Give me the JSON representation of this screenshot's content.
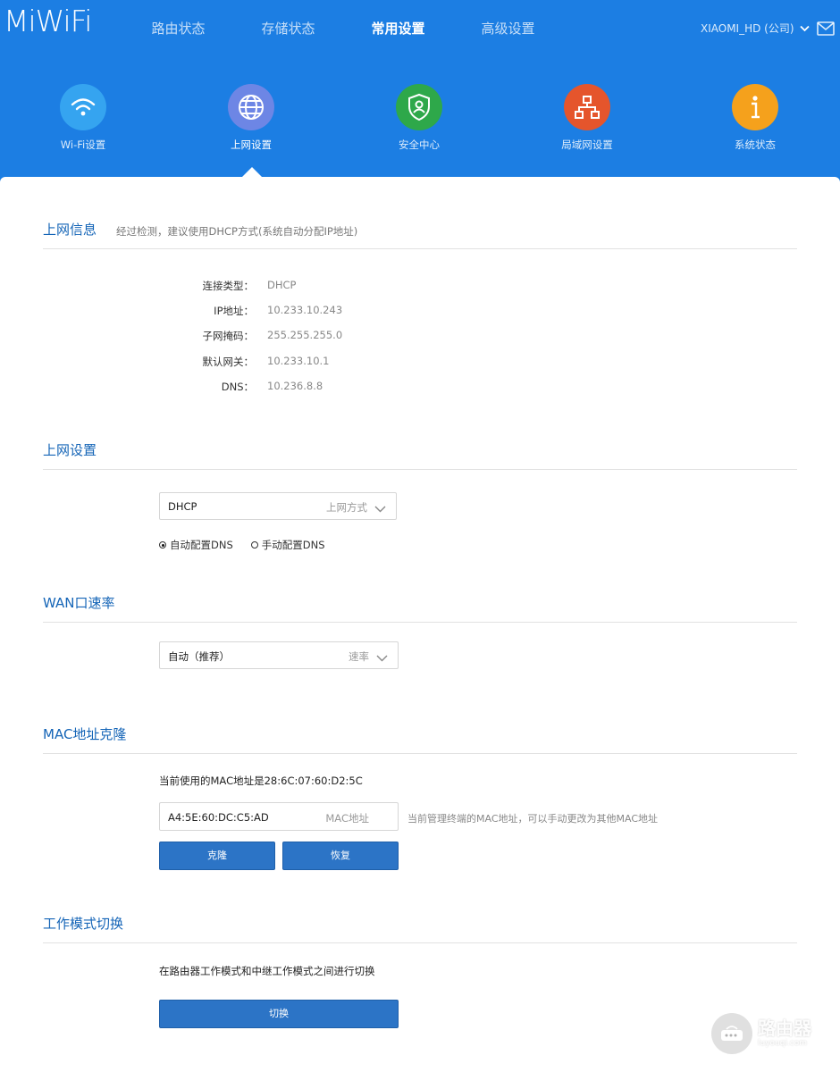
{
  "header": {
    "logo": "MiWiFi",
    "nav": [
      {
        "label": "路由状态"
      },
      {
        "label": "存储状态"
      },
      {
        "label": "常用设置"
      },
      {
        "label": "高级设置"
      }
    ],
    "account": "XIAOMI_HD (公司)"
  },
  "icons": [
    {
      "label": "Wi-Fi设置",
      "color": "#35a4f0",
      "icon": "wifi-icon"
    },
    {
      "label": "上网设置",
      "color": "#6d86e5",
      "icon": "globe-icon"
    },
    {
      "label": "安全中心",
      "color": "#2ea84a",
      "icon": "shield-icon"
    },
    {
      "label": "局域网设置",
      "color": "#e5552c",
      "icon": "network-icon"
    },
    {
      "label": "系统状态",
      "color": "#f5a11c",
      "icon": "info-icon"
    }
  ],
  "wan_info": {
    "title": "上网信息",
    "subtitle": "经过检测，建议使用DHCP方式(系统自动分配IP地址)",
    "rows": [
      {
        "key": "连接类型：",
        "value": "DHCP"
      },
      {
        "key": "IP地址：",
        "value": "10.233.10.243"
      },
      {
        "key": "子网掩码：",
        "value": "255.255.255.0"
      },
      {
        "key": "默认网关：",
        "value": "10.233.10.1"
      },
      {
        "key": "DNS：",
        "value": "10.236.8.8"
      }
    ]
  },
  "wan_settings": {
    "title": "上网设置",
    "mode_value": "DHCP",
    "mode_hint": "上网方式",
    "dns_auto": "自动配置DNS",
    "dns_manual": "手动配置DNS"
  },
  "wan_speed": {
    "title": "WAN口速率",
    "value": "自动（推荐）",
    "hint": "速率"
  },
  "mac_clone": {
    "title": "MAC地址克隆",
    "current": "当前使用的MAC地址是28:6C:07:60:D2:5C",
    "input_value": "A4:5E:60:DC:C5:AD",
    "input_hint": "MAC地址",
    "note": "当前管理终端的MAC地址，可以手动更改为其他MAC地址",
    "clone_label": "克隆",
    "restore_label": "恢复"
  },
  "work_mode": {
    "title": "工作模式切换",
    "desc": "在路由器工作模式和中继工作模式之间进行切换",
    "switch_label": "切换"
  },
  "watermark": {
    "big": "路由器",
    "small": "luyouqi.com"
  }
}
